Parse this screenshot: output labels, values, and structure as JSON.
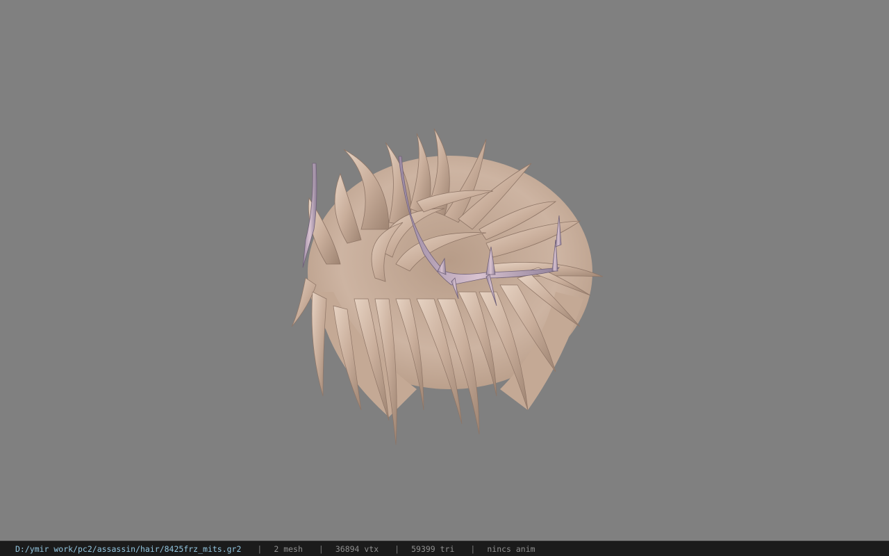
{
  "viewport": {
    "background_color": "#808080",
    "model": "hair mesh with thorn crown",
    "hair_color": "#d2b8a6",
    "crown_color": "#b8a3ba"
  },
  "status_bar": {
    "file_path": "D:/ymir work/pc2/assassin/hair/8425frz_mits.gr2",
    "separator": "|",
    "mesh_count": "2 mesh",
    "vertex_count": "36894 vtx",
    "triangle_count": "59399 tri",
    "anim_status": "nincs anim"
  }
}
